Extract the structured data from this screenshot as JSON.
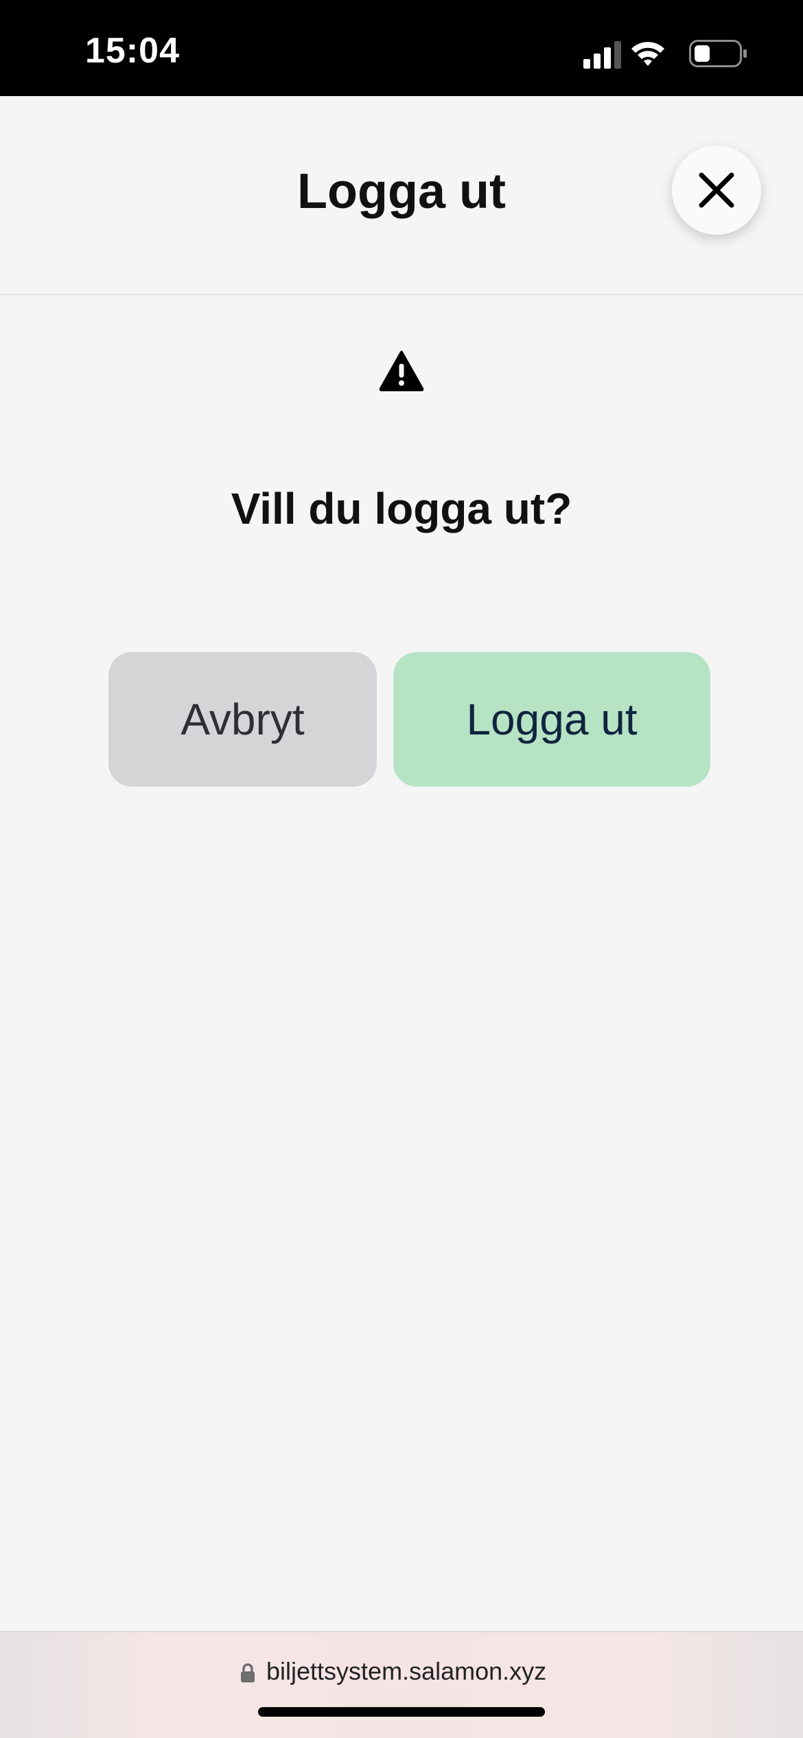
{
  "status_bar": {
    "time": "15:04",
    "icons": [
      "signal-icon",
      "wifi-icon",
      "battery-icon"
    ]
  },
  "modal": {
    "title": "Logga ut",
    "close_icon": "close-icon",
    "warning_icon": "warning-icon",
    "prompt": "Vill du logga ut?",
    "cancel_label": "Avbryt",
    "confirm_label": "Logga ut"
  },
  "browser": {
    "url": "biljettsystem.salamon.xyz",
    "lock_icon": "lock-icon"
  },
  "colors": {
    "cancel_bg": "#d5d5d7",
    "confirm_bg": "#b6e3c4",
    "page_bg": "#f5f5f5"
  }
}
